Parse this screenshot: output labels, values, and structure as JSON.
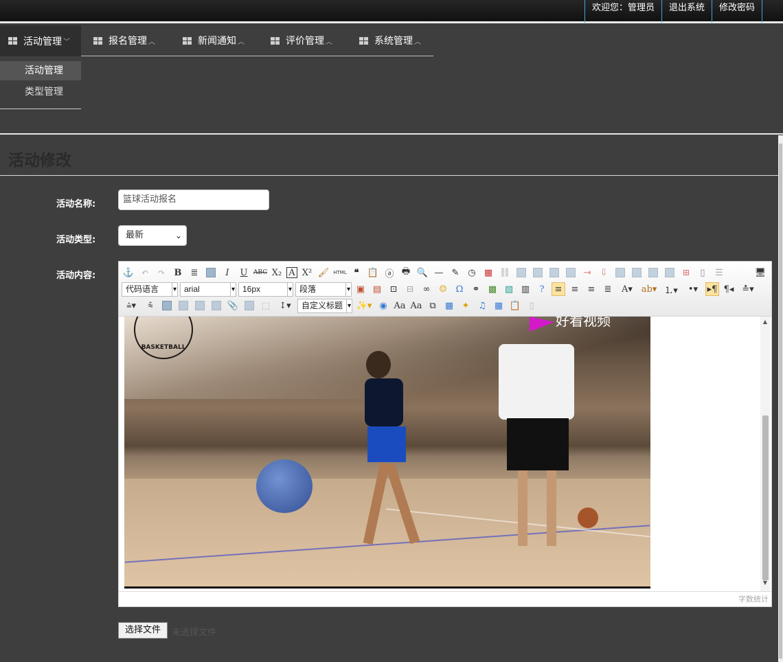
{
  "header": {
    "welcome": "欢迎您：管理员",
    "logout": "退出系统",
    "change_password": "修改密码"
  },
  "nav": [
    {
      "label": "活动管理",
      "active": true
    },
    {
      "label": "报名管理",
      "active": false
    },
    {
      "label": "新闻通知",
      "active": false
    },
    {
      "label": "评价管理",
      "active": false
    },
    {
      "label": "系统管理",
      "active": false
    }
  ],
  "submenu": [
    {
      "label": "活动管理",
      "active": true
    },
    {
      "label": "类型管理",
      "active": false
    }
  ],
  "page": {
    "title": "活动修改"
  },
  "form": {
    "name_label": "活动名称:",
    "name_value": "篮球活动报名",
    "type_label": "活动类型:",
    "type_value": "最新",
    "content_label": "活动内容:"
  },
  "editor": {
    "code_lang": "代码语言",
    "font_family": "arial",
    "font_size": "16px",
    "paragraph": "段落",
    "custom_title": "自定义标题",
    "word_count": "字数统计",
    "video_watermark": "好看视频",
    "logo_text": "BASKETBALL"
  },
  "file": {
    "button": "选择文件",
    "status": "未选择文件"
  },
  "colors": {
    "background": "#3e3e3e",
    "accent_border": "#4aa3d8",
    "highlight_button": "#fbe3a0"
  }
}
